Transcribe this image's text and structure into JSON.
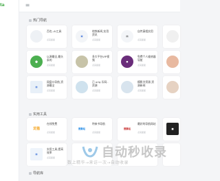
{
  "brand": {
    "logo_text": "ta"
  },
  "topbar": {
    "menu_icon": "menu-icon"
  },
  "sections": [
    {
      "title": "热门导航"
    },
    {
      "title": "实用工具"
    },
    {
      "title": "导航库"
    }
  ],
  "hot": [
    {
      "title": "百也..AI工具",
      "sub": "点亮星星"
    },
    {
      "title": "地铁新闻,实用资讯",
      "sub": "点亮星星"
    },
    {
      "title": "自传真相实用",
      "sub": "点亮星星"
    },
    {
      "title": "",
      "sub": ""
    },
    {
      "title": "以源最全,最头条的",
      "sub": "点亮星星"
    },
    {
      "title": "多大平台VIP视频",
      "sub": "点亮星星"
    },
    {
      "title": "免费个人维修器导航",
      "sub": "点亮星星"
    },
    {
      "title": "",
      "sub": ""
    },
    {
      "title": "网盘口导航,资源最全",
      "sub": "点亮星星"
    },
    {
      "title": "已 orig 乐网..资源",
      "sub": "点亮星星"
    },
    {
      "title": "模影字资源,资源新闻",
      "sub": "点亮星星"
    },
    {
      "title": "",
      "sub": ""
    }
  ],
  "tools": [
    {
      "title": "在线免费",
      "sub": "点亮星星",
      "logo": "龙猫"
    },
    {
      "title": "特来书导航",
      "sub": "点亮星星",
      "logo": "搜集站"
    },
    {
      "title": "最好的导航网站",
      "sub": "点亮星星",
      "logo": "搜集站"
    },
    {
      "title": "",
      "sub": ""
    },
    {
      "title": "实用工具,提高效率",
      "sub": "点亮星星"
    },
    {
      "title": "",
      "sub": ""
    },
    {
      "title": "",
      "sub": ""
    },
    {
      "title": "",
      "sub": ""
    }
  ],
  "watermark": {
    "main": "自动秒收录",
    "sub": "数上精华→来访一次→自动收录"
  }
}
